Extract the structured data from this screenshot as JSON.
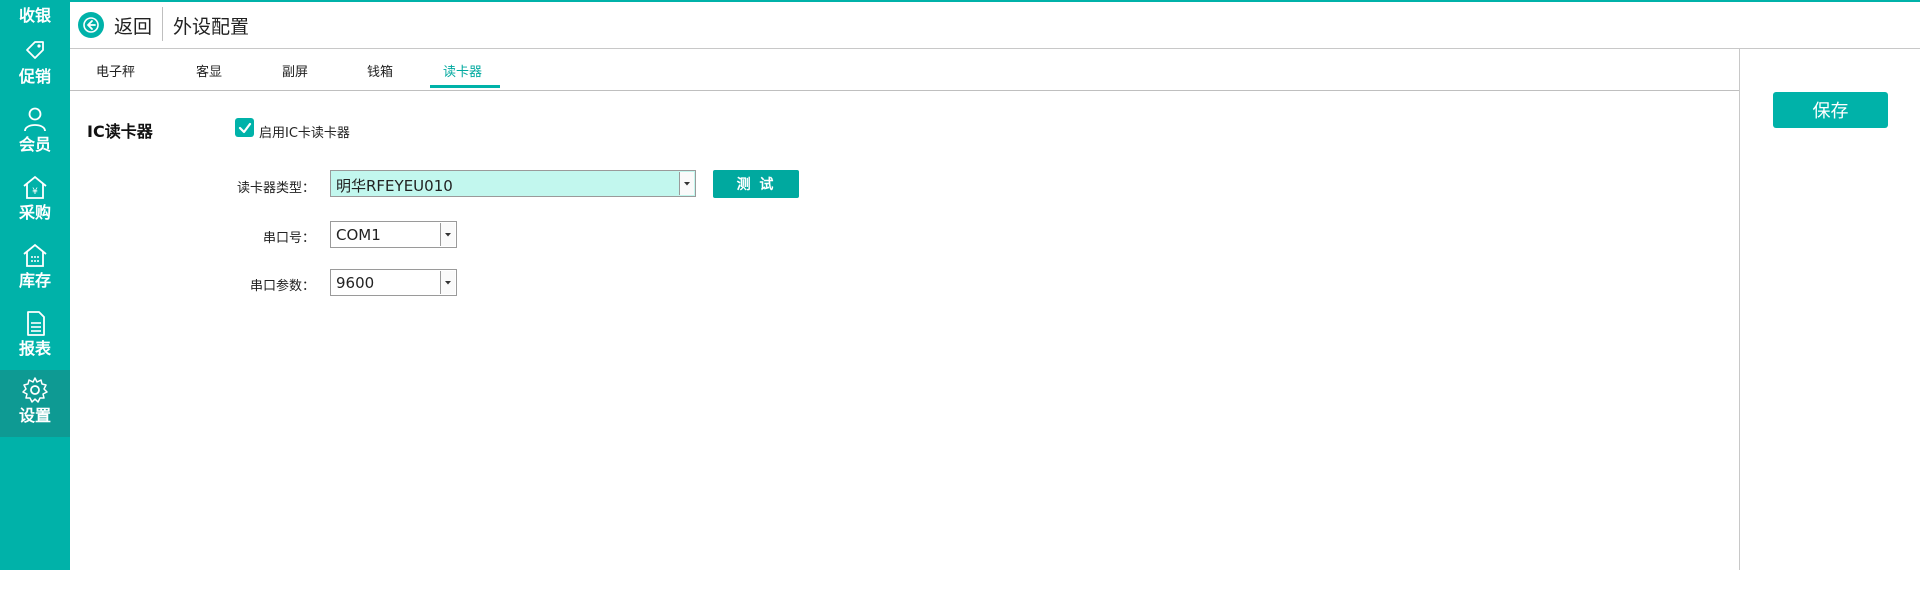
{
  "sidebar": {
    "items": [
      {
        "label": "收银",
        "icon": "cashier-icon"
      },
      {
        "label": "促销",
        "icon": "tag-icon"
      },
      {
        "label": "会员",
        "icon": "user-icon"
      },
      {
        "label": "采购",
        "icon": "purchase-icon"
      },
      {
        "label": "库存",
        "icon": "warehouse-icon"
      },
      {
        "label": "报表",
        "icon": "document-icon"
      },
      {
        "label": "设置",
        "icon": "gear-icon"
      }
    ],
    "active_index": 6
  },
  "header": {
    "back_label": "返回",
    "title": "外设配置"
  },
  "tabs": [
    {
      "label": "电子秤"
    },
    {
      "label": "客显"
    },
    {
      "label": "副屏"
    },
    {
      "label": "钱箱"
    },
    {
      "label": "读卡器"
    }
  ],
  "active_tab": "读卡器",
  "save_label": "保存",
  "section": {
    "title": "IC读卡器",
    "enable_label": "启用IC卡读卡器",
    "enabled": true
  },
  "fields": {
    "reader_type": {
      "label": "读卡器类型：",
      "value": "明华RFEYEU010"
    },
    "test_label": "测 试",
    "port": {
      "label": "串口号：",
      "value": "COM1"
    },
    "baud": {
      "label": "串口参数：",
      "value": "9600"
    }
  },
  "colors": {
    "accent": "#00b2a9",
    "sidebar_active": "#0e9a93",
    "select_highlight": "#c2f7ee"
  }
}
